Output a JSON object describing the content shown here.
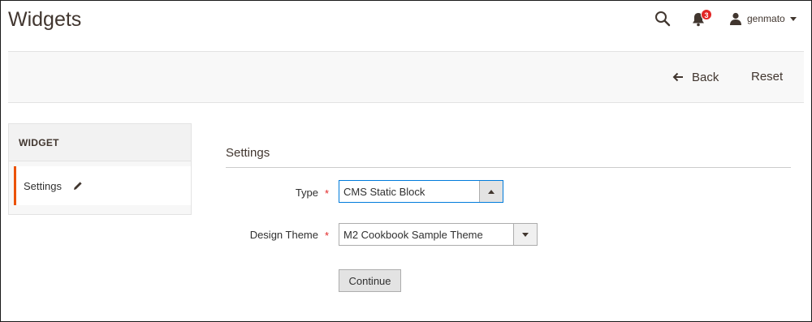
{
  "header": {
    "title": "Widgets",
    "notifications_count": "3",
    "user_name": "genmato"
  },
  "actions": {
    "back_label": "Back",
    "reset_label": "Reset"
  },
  "sidebar": {
    "heading": "WIDGET",
    "items": [
      {
        "label": "Settings",
        "icon": "pencil-icon"
      }
    ]
  },
  "form": {
    "section_title": "Settings",
    "type_label": "Type",
    "type_value": "CMS Static Block",
    "design_theme_label": "Design Theme",
    "design_theme_value": "M2 Cookbook Sample Theme",
    "required_mark": "*",
    "continue_label": "Continue"
  },
  "colors": {
    "accent": "#eb5202",
    "badge": "#e22626",
    "required": "#e22626",
    "focus": "#007bdb"
  }
}
